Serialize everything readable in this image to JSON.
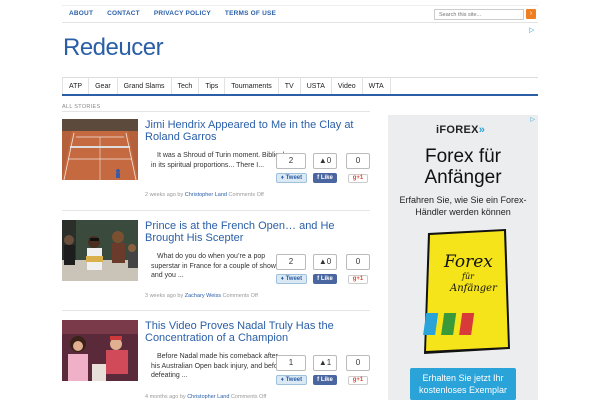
{
  "top_nav": [
    "ABOUT",
    "CONTACT",
    "PRIVACY POLICY",
    "TERMS OF USE"
  ],
  "search": {
    "placeholder": "Search this site..."
  },
  "site": {
    "title": "Redeucer"
  },
  "category_nav": [
    "ATP",
    "Gear",
    "Grand Slams",
    "Tech",
    "Tips",
    "Tournaments",
    "TV",
    "USTA",
    "Video",
    "WTA"
  ],
  "section_label": "ALL STORIES",
  "stories": [
    {
      "title": "Jimi Hendrix Appeared to Me in the Clay at Roland Garros",
      "excerpt": "It was a Shroud of Turin moment. Biblical in its spiritual proportions... There I...",
      "tweet_count": "2",
      "like_count": "0",
      "plus_count": "0",
      "tweet_label": "Tweet",
      "like_label": "Like",
      "plus_label": "+1",
      "time": "2 weeks ago by",
      "author": "Christopher Land",
      "comments": "Comments Off"
    },
    {
      "title": "Prince is at the French Open… and He Brought His Scepter",
      "excerpt": "What do you do when you’re a pop superstar in France for a couple of shows and you ...",
      "tweet_count": "2",
      "like_count": "0",
      "plus_count": "0",
      "tweet_label": "Tweet",
      "like_label": "Like",
      "plus_label": "+1",
      "time": "3 weeks ago by",
      "author": "Zachary Weiss",
      "comments": "Comments Off"
    },
    {
      "title": "This Video Proves Nadal Truly Has the Concentration of a Champion",
      "excerpt": "Before Nadal made his comeback after his Australian Open back injury, and before defeating ...",
      "tweet_count": "1",
      "like_count": "1",
      "plus_count": "0",
      "tweet_label": "Tweet",
      "like_label": "Like",
      "plus_label": "+1",
      "time": "4 months ago by",
      "author": "Christopher Land",
      "comments": "Comments Off"
    }
  ],
  "ad": {
    "brand": "iFOREX",
    "headline": "Forex für Anfänger",
    "subline": "Erfahren Sie, wie Sie ein Forex-Händler werden können",
    "book_title": "Forex",
    "book_small": "für",
    "book_sub": "Anfänger",
    "cta": "Erhalten Sie jetzt Ihr kostenloses Exemplar"
  },
  "colors": {
    "accent": "#2a5fa8",
    "ad_blue": "#2aa3d8",
    "book_yellow": "#f5e41a"
  }
}
